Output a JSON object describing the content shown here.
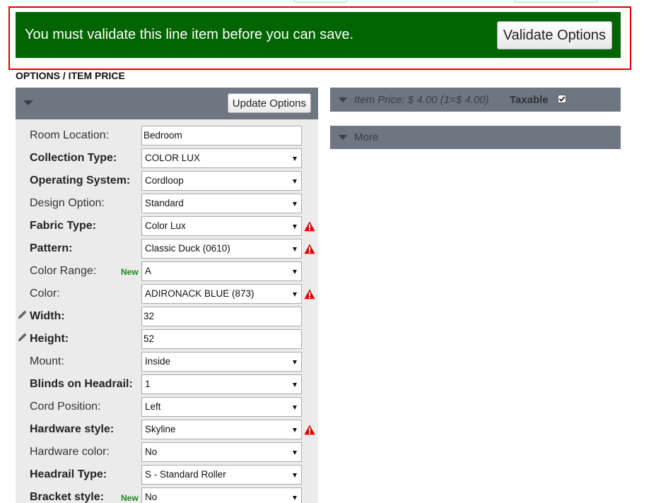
{
  "alert": {
    "message": "You must validate this line item before you can save.",
    "validate_label": "Validate Options",
    "bg_color": "#006400",
    "highlight_color": "#e00000"
  },
  "section_title": "OPTIONS / ITEM PRICE",
  "options_panel": {
    "update_label": "Update Options",
    "header_color": "#6e7682",
    "rows": [
      {
        "label": "Room Location:",
        "bold": false,
        "type": "text",
        "value": "Bedroom",
        "warning": false,
        "new": false,
        "edited": false
      },
      {
        "label": "Collection Type:",
        "bold": true,
        "type": "select",
        "value": "COLOR LUX",
        "warning": false,
        "new": false,
        "edited": false
      },
      {
        "label": "Operating System:",
        "bold": true,
        "type": "select",
        "value": "Cordloop",
        "warning": false,
        "new": false,
        "edited": false
      },
      {
        "label": "Design Option:",
        "bold": false,
        "type": "select",
        "value": "Standard",
        "warning": false,
        "new": false,
        "edited": false
      },
      {
        "label": "Fabric Type:",
        "bold": true,
        "type": "select",
        "value": "Color Lux",
        "warning": true,
        "new": false,
        "edited": false
      },
      {
        "label": "Pattern:",
        "bold": true,
        "type": "select",
        "value": "Classic Duck (0610)",
        "warning": true,
        "new": false,
        "edited": false
      },
      {
        "label": "Color Range:",
        "bold": false,
        "type": "select",
        "value": "A",
        "warning": false,
        "new": true,
        "edited": false
      },
      {
        "label": "Color:",
        "bold": false,
        "type": "select",
        "value": "ADIRONACK BLUE (873)",
        "warning": true,
        "new": false,
        "edited": false
      },
      {
        "label": "Width:",
        "bold": true,
        "type": "text",
        "value": "32",
        "warning": false,
        "new": false,
        "edited": true
      },
      {
        "label": "Height:",
        "bold": true,
        "type": "text",
        "value": "52",
        "warning": false,
        "new": false,
        "edited": true
      },
      {
        "label": "Mount:",
        "bold": false,
        "type": "select",
        "value": "Inside",
        "warning": false,
        "new": false,
        "edited": false
      },
      {
        "label": "Blinds on Headrail:",
        "bold": true,
        "type": "select",
        "value": "1",
        "warning": false,
        "new": false,
        "edited": false
      },
      {
        "label": "Cord Position:",
        "bold": false,
        "type": "select",
        "value": "Left",
        "warning": false,
        "new": false,
        "edited": false
      },
      {
        "label": "Hardware style:",
        "bold": true,
        "type": "select",
        "value": "Skyline",
        "warning": true,
        "new": false,
        "edited": false
      },
      {
        "label": "Hardware color:",
        "bold": false,
        "type": "select",
        "value": "No",
        "warning": false,
        "new": false,
        "edited": false
      },
      {
        "label": "Headrail Type:",
        "bold": true,
        "type": "select",
        "value": "S - Standard Roller",
        "warning": false,
        "new": false,
        "edited": false
      },
      {
        "label": "Bracket style:",
        "bold": true,
        "type": "select",
        "value": "No",
        "warning": false,
        "new": true,
        "edited": false
      }
    ],
    "new_tag": "New"
  },
  "price_panel": {
    "price_text": "Item Price: $ 4.00 (1=$ 4.00)",
    "taxable_label": "Taxable",
    "taxable_checked": true,
    "more_label": "More"
  }
}
